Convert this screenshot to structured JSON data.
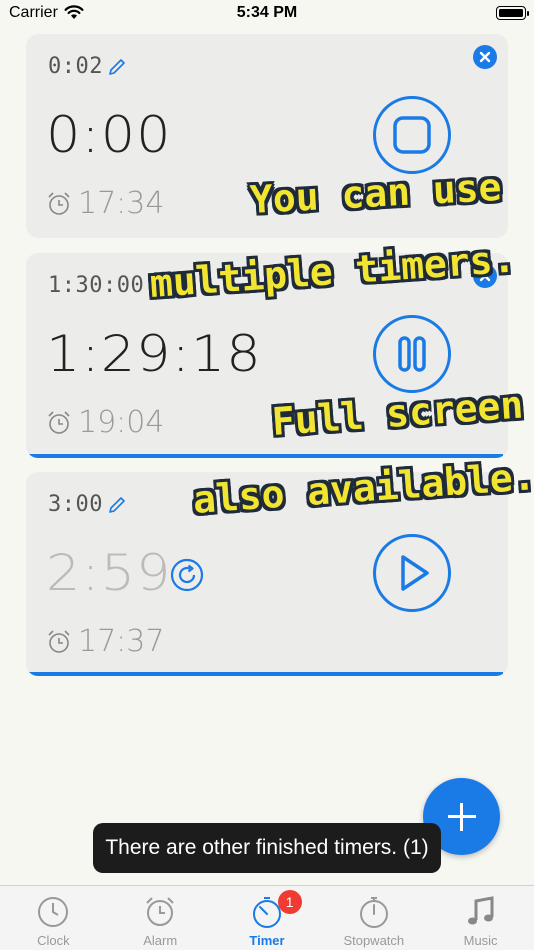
{
  "status_bar": {
    "carrier": "Carrier",
    "time": "5:34 PM"
  },
  "timers": [
    {
      "set": "0:02",
      "remaining": "0:00",
      "alarm": "17:34",
      "state": "finished",
      "progress": 0
    },
    {
      "set": "1:30:00",
      "remaining": "1:29:18",
      "alarm": "19:04",
      "state": "running",
      "progress": 0.99
    },
    {
      "set": "3:00",
      "remaining": "2:59",
      "alarm": "17:37",
      "state": "paused",
      "progress": 0.99
    }
  ],
  "promo": {
    "line1": "You can use",
    "line2": "multiple timers.",
    "line3": "Full screen",
    "line4": "also available."
  },
  "toast": {
    "message": "There are other finished timers. (1)"
  },
  "tabs": [
    {
      "label": "Clock",
      "icon": "clock-icon"
    },
    {
      "label": "Alarm",
      "icon": "alarm-icon"
    },
    {
      "label": "Timer",
      "icon": "timer-icon",
      "badge": "1"
    },
    {
      "label": "Stopwatch",
      "icon": "stopwatch-icon"
    },
    {
      "label": "Music",
      "icon": "music-note-icon"
    }
  ],
  "colors": {
    "accent": "#1a7ae6",
    "badge": "#f03b33",
    "promo_text": "#f2e531"
  }
}
